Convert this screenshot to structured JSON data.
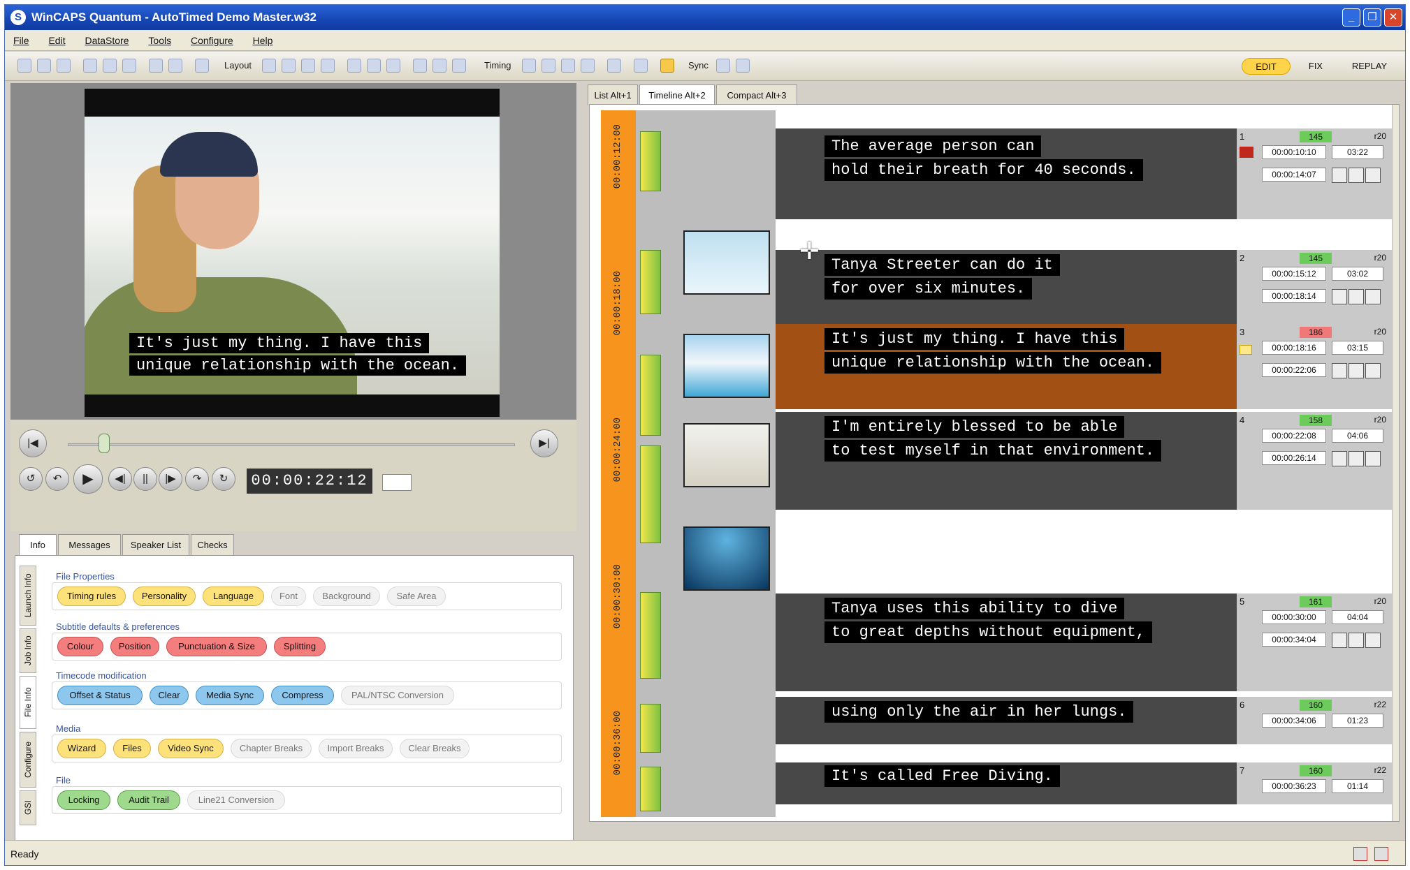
{
  "window": {
    "title": "WinCAPS Quantum - AutoTimed Demo Master.w32"
  },
  "menu": [
    "File",
    "Edit",
    "DataStore",
    "Tools",
    "Configure",
    "Help"
  ],
  "toolbar": {
    "layout_label": "Layout",
    "timing_label": "Timing",
    "sync_label": "Sync",
    "modes": [
      "EDIT",
      "FIX",
      "REPLAY"
    ]
  },
  "player": {
    "caption": [
      "It's just my thing. I have this",
      "unique relationship with the ocean."
    ],
    "timecode": "00:00:22:12"
  },
  "info_tabs": [
    "Info",
    "Messages",
    "Speaker List",
    "Checks"
  ],
  "side_tabs": [
    "Launch Info",
    "Job Info",
    "File Info",
    "Configure",
    "GSI"
  ],
  "groups": [
    {
      "title": "File Properties",
      "buttons": [
        {
          "label": "Timing rules",
          "color": "yellow"
        },
        {
          "label": "Personality",
          "color": "yellow"
        },
        {
          "label": "Language",
          "color": "yellow"
        },
        {
          "label": "Font",
          "color": "gray"
        },
        {
          "label": "Background",
          "color": "gray"
        },
        {
          "label": "Safe Area",
          "color": "gray"
        }
      ]
    },
    {
      "title": "Subtitle defaults & preferences",
      "buttons": [
        {
          "label": "Colour",
          "color": "red"
        },
        {
          "label": "Position",
          "color": "red"
        },
        {
          "label": "Punctuation & Size",
          "color": "red"
        },
        {
          "label": "Splitting",
          "color": "red"
        }
      ]
    },
    {
      "title": "Timecode modification",
      "buttons": [
        {
          "label": "Offset & Status",
          "color": "blue"
        },
        {
          "label": "Clear",
          "color": "blue"
        },
        {
          "label": "Media Sync",
          "color": "blue"
        },
        {
          "label": "Compress",
          "color": "blue"
        },
        {
          "label": "PAL/NTSC Conversion",
          "color": "gray"
        }
      ]
    },
    {
      "title": "Media",
      "buttons": [
        {
          "label": "Wizard",
          "color": "yellow"
        },
        {
          "label": "Files",
          "color": "yellow"
        },
        {
          "label": "Video Sync",
          "color": "yellow"
        },
        {
          "label": "Chapter Breaks",
          "color": "gray"
        },
        {
          "label": "Import Breaks",
          "color": "gray"
        },
        {
          "label": "Clear Breaks",
          "color": "gray"
        }
      ]
    },
    {
      "title": "File",
      "buttons": [
        {
          "label": "Locking",
          "color": "green"
        },
        {
          "label": "Audit Trail",
          "color": "green"
        },
        {
          "label": "Line21 Conversion",
          "color": "gray"
        }
      ]
    }
  ],
  "view_tabs": [
    "List Alt+1",
    "Timeline Alt+2",
    "Compact Alt+3"
  ],
  "ruler_ticks": [
    "00:00:12:00",
    "00:00:18:00",
    "00:00:24:00",
    "00:00:30:00",
    "00:00:36:00"
  ],
  "subtitles": [
    {
      "num": "1",
      "lines": [
        "The average person can",
        "hold their breath for 40 seconds."
      ],
      "cps": "145",
      "cps_color": "g",
      "r": "r20",
      "in": "00:00:10:10",
      "dur": "03:22",
      "out": "00:00:14:07",
      "active": false
    },
    {
      "num": "2",
      "lines": [
        "Tanya Streeter can do it",
        "for over six minutes."
      ],
      "cps": "145",
      "cps_color": "g",
      "r": "r20",
      "in": "00:00:15:12",
      "dur": "03:02",
      "out": "00:00:18:14",
      "active": false
    },
    {
      "num": "3",
      "lines": [
        "It's just my thing. I have this",
        "unique relationship with the ocean."
      ],
      "cps": "186",
      "cps_color": "r",
      "r": "r20",
      "in": "00:00:18:16",
      "dur": "03:15",
      "out": "00:00:22:06",
      "active": true
    },
    {
      "num": "4",
      "lines": [
        "I'm entirely blessed to be able",
        "to test myself in that environment."
      ],
      "cps": "158",
      "cps_color": "g",
      "r": "r20",
      "in": "00:00:22:08",
      "dur": "04:06",
      "out": "00:00:26:14",
      "active": false
    },
    {
      "num": "5",
      "lines": [
        "Tanya uses this ability to dive",
        "to great depths without equipment,"
      ],
      "cps": "161",
      "cps_color": "g",
      "r": "r20",
      "in": "00:00:30:00",
      "dur": "04:04",
      "out": "00:00:34:04",
      "active": false
    },
    {
      "num": "6",
      "lines": [
        "using only the air in her lungs."
      ],
      "cps": "160",
      "cps_color": "g",
      "r": "r22",
      "in": "00:00:34:06",
      "dur": "01:23",
      "out": "",
      "active": false
    },
    {
      "num": "7",
      "lines": [
        "It's called Free Diving."
      ],
      "cps": "160",
      "cps_color": "g",
      "r": "r22",
      "in": "00:00:36:23",
      "dur": "01:14",
      "out": "",
      "active": false
    }
  ],
  "status": "Ready"
}
